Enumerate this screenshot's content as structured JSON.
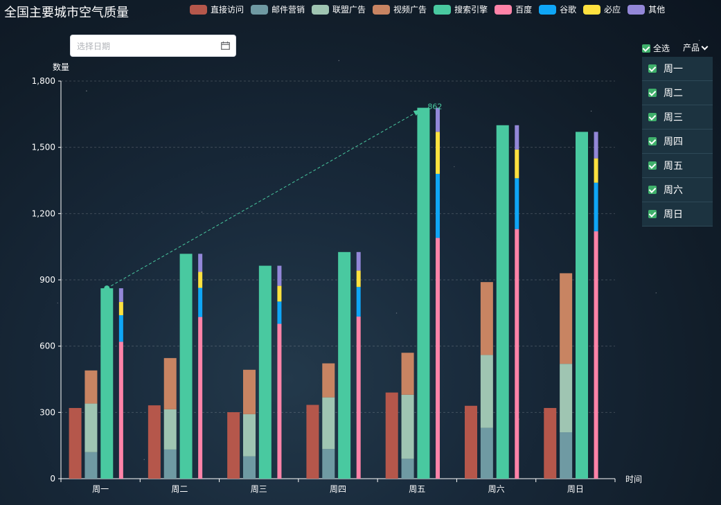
{
  "title": "全国主要城市空气质量",
  "date_picker": {
    "placeholder": "选择日期"
  },
  "panel": {
    "select_all_label": "全选",
    "product_label": "产品",
    "days": [
      "周一",
      "周二",
      "周三",
      "周四",
      "周五",
      "周六",
      "周日"
    ]
  },
  "chart_data": {
    "type": "bar",
    "ylabel": "数量",
    "xlabel": "时间",
    "ylim": [
      0,
      1800
    ],
    "yticks": [
      0,
      300,
      600,
      900,
      1200,
      1500,
      1800
    ],
    "ytick_labels": [
      "0",
      "300",
      "600",
      "900",
      "1,200",
      "1,500",
      "1,800"
    ],
    "grid": true,
    "legend_position": "top",
    "categories": [
      "周一",
      "周二",
      "周三",
      "周四",
      "周五",
      "周六",
      "周日"
    ],
    "series": [
      {
        "name": "直接访问",
        "stack": "a",
        "color": "#b5574b",
        "values": [
          320,
          332,
          301,
          334,
          390,
          330,
          320
        ]
      },
      {
        "name": "邮件营销",
        "stack": "b",
        "color": "#6f9aa3",
        "values": [
          120,
          132,
          101,
          134,
          90,
          230,
          210
        ]
      },
      {
        "name": "联盟广告",
        "stack": "b",
        "color": "#9fc5b2",
        "values": [
          220,
          182,
          191,
          234,
          290,
          330,
          310
        ]
      },
      {
        "name": "视频广告",
        "stack": "b",
        "color": "#c88462",
        "values": [
          150,
          232,
          201,
          154,
          190,
          330,
          410
        ]
      },
      {
        "name": "搜索引擎",
        "stack": "c",
        "color": "#49c9a0",
        "values": [
          862,
          1018,
          964,
          1026,
          1679,
          1600,
          1570
        ]
      },
      {
        "name": "百度",
        "stack": "d",
        "color": "#ff83a8",
        "values": [
          620,
          732,
          701,
          734,
          1090,
          1130,
          1120
        ]
      },
      {
        "name": "谷歌",
        "stack": "d",
        "color": "#0fa6f6",
        "values": [
          120,
          132,
          101,
          134,
          290,
          230,
          220
        ]
      },
      {
        "name": "必应",
        "stack": "d",
        "color": "#fee13f",
        "values": [
          60,
          72,
          71,
          74,
          190,
          130,
          110
        ]
      },
      {
        "name": "其他",
        "stack": "d",
        "color": "#9387d8",
        "values": [
          62,
          82,
          91,
          84,
          109,
          110,
          120
        ]
      }
    ],
    "markline": {
      "from": "周一",
      "to": "周五",
      "series": "搜索引擎",
      "label": "862"
    }
  }
}
